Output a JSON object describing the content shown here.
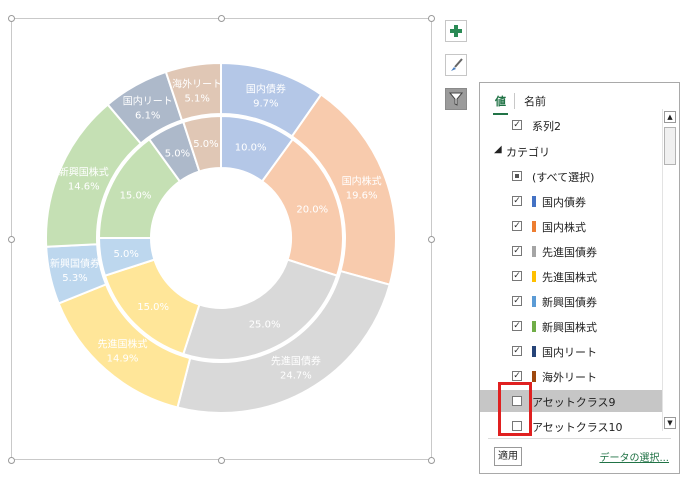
{
  "chart_data": {
    "type": "pie",
    "subtype": "doughnut",
    "outer_series": {
      "name": "系列2",
      "categories": [
        "国内債券",
        "国内株式",
        "先進国債券",
        "先進国株式",
        "新興国債券",
        "新興国株式",
        "国内リート",
        "海外リート"
      ],
      "values": [
        9.7,
        19.6,
        24.7,
        14.9,
        5.3,
        14.6,
        6.1,
        5.1
      ],
      "labels": [
        "国内債券\n9.7%",
        "国内株式\n19.6%",
        "先進国債券\n24.7%",
        "先進国株式\n14.9%",
        "新興国債券\n5.3%",
        "新興国株式\n14.6%",
        "国内リート\n6.1%",
        "海外リート\n5.1%"
      ]
    },
    "inner_series": {
      "values": [
        10.0,
        20.0,
        25.0,
        15.0,
        5.0,
        15.0,
        5.0,
        5.0
      ],
      "labels": [
        "10.0%",
        "20.0%",
        "25.0%",
        "15.0%",
        "5.0%",
        "15.0%",
        "5.0%",
        "5.0%"
      ]
    },
    "colors": [
      "#b4c7e7",
      "#f8cbad",
      "#d9d9d9",
      "#ffe699",
      "#bdd7ee",
      "#c5e0b4",
      "#adb9ca",
      "#e0c7b5"
    ]
  },
  "side_buttons": [
    {
      "icon": "plus-icon"
    },
    {
      "icon": "brush-icon"
    },
    {
      "icon": "filter-icon"
    }
  ],
  "panel": {
    "tab_values": "値",
    "tab_names": "名前",
    "series_label": "系列2",
    "category_header": "カテゴリ",
    "rows": [
      {
        "label": "(すべて選択)",
        "state": "partial",
        "color": ""
      },
      {
        "label": "国内債券",
        "state": "checked",
        "color": "#4472c4"
      },
      {
        "label": "国内株式",
        "state": "checked",
        "color": "#ed7d31"
      },
      {
        "label": "先進国債券",
        "state": "checked",
        "color": "#a5a5a5"
      },
      {
        "label": "先進国株式",
        "state": "checked",
        "color": "#ffc000"
      },
      {
        "label": "新興国債券",
        "state": "checked",
        "color": "#5b9bd5"
      },
      {
        "label": "新興国株式",
        "state": "checked",
        "color": "#70ad47"
      },
      {
        "label": "国内リート",
        "state": "checked",
        "color": "#264478"
      },
      {
        "label": "海外リート",
        "state": "checked",
        "color": "#9e480e"
      },
      {
        "label": "アセットクラス9",
        "state": "unchecked",
        "color": ""
      },
      {
        "label": "アセットクラス10",
        "state": "unchecked",
        "color": ""
      }
    ],
    "apply_label": "適用",
    "select_data_label": "データの選択..."
  }
}
